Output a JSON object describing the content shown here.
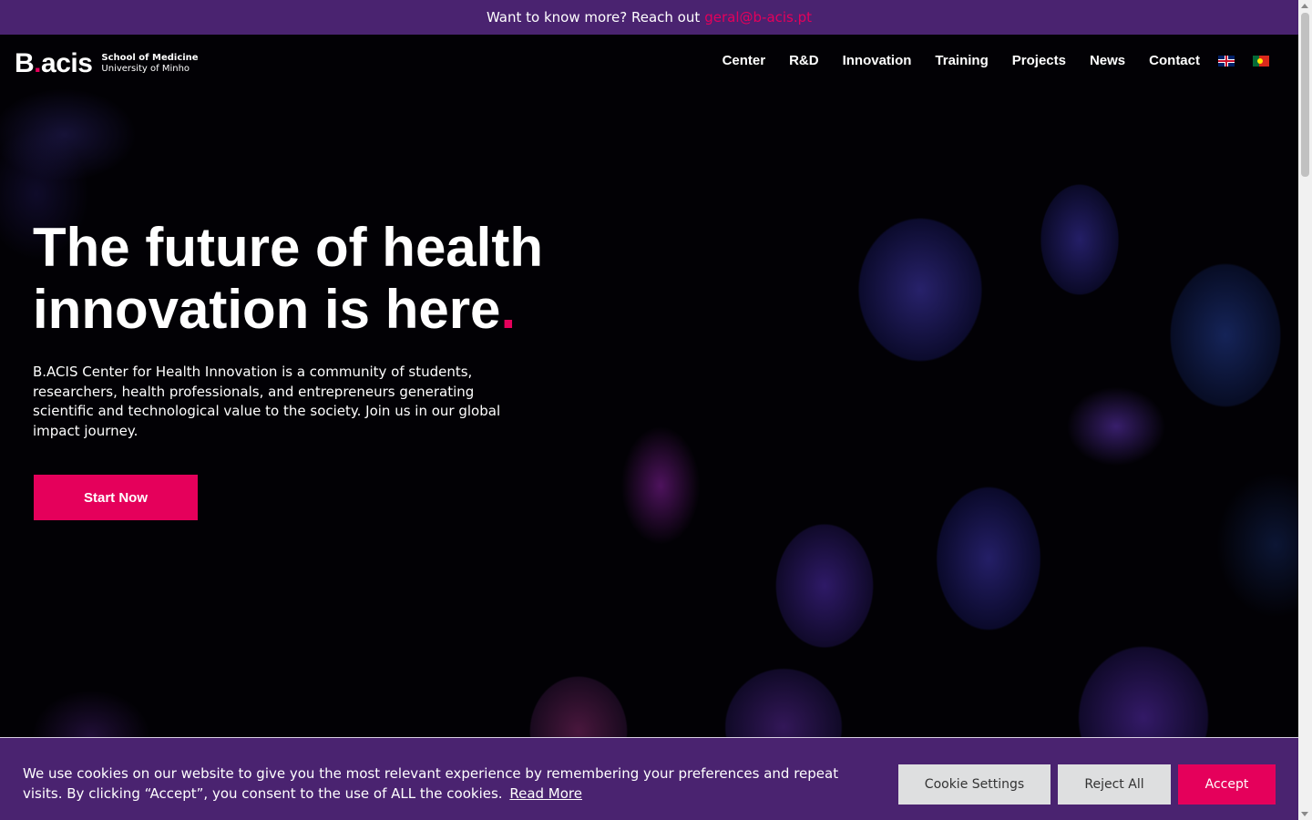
{
  "topbar": {
    "text": "Want to know more? Reach out",
    "email": "geral@b-acis.pt"
  },
  "logo": {
    "brand_b": "B",
    "brand_dot": ".",
    "brand_rest": "acis",
    "line1": "School of Medicine",
    "line2": "University of Minho"
  },
  "nav": {
    "items": [
      "Center",
      "R&D",
      "Innovation",
      "Training",
      "Projects",
      "News",
      "Contact"
    ],
    "flags": [
      "flag-uk-icon",
      "flag-pt-icon"
    ]
  },
  "hero": {
    "title_line1": "The future of health",
    "title_line2": "innovation is here",
    "title_dot": ".",
    "description": "B.ACIS Center for Health Innovation is a community of students, researchers, health professionals, and entrepreneurs generating scientific and technological value to the society. Join us in our global impact journey.",
    "cta": "Start Now"
  },
  "cookie": {
    "text": "We use cookies on our website to give you the most relevant experience by remembering your preferences and repeat visits. By clicking “Accept”, you consent to the use of ALL the cookies.",
    "read_more": "Read More",
    "settings": "Cookie Settings",
    "reject": "Reject All",
    "accept": "Accept"
  },
  "colors": {
    "brand_purple": "#4a2370",
    "accent_pink": "#e5005b"
  }
}
